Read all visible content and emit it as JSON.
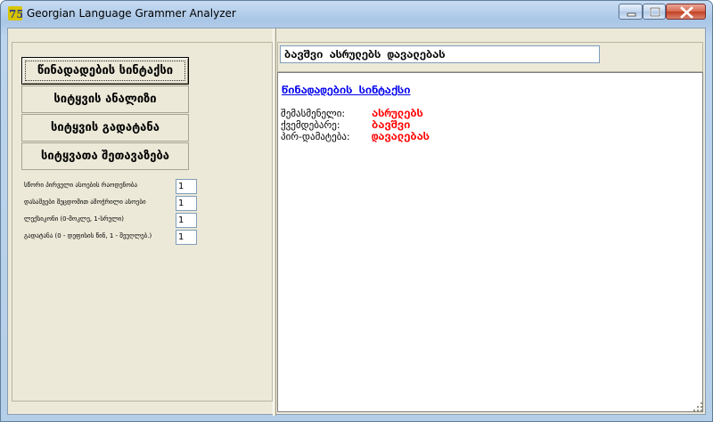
{
  "window": {
    "title": "Georgian Language Grammer Analyzer"
  },
  "controls": {
    "minimize": "minimize",
    "maximize": "maximize",
    "close": "close"
  },
  "left_panel": {
    "buttons": [
      "წინადადების სინტაქსი",
      "სიტყვის ანალიზი",
      "სიტყვის გადატანა",
      "სიტყვათა შეთავაზება"
    ],
    "params": [
      {
        "label": "სწორი პირველი ასოების რაოდენობა",
        "value": "1"
      },
      {
        "label": "დასაშვები შეცდომით ამოჭრილი  ასოები",
        "value": "1"
      },
      {
        "label": "ლექსიკონი (0-მოკლე, 1-სრული)",
        "value": "1"
      },
      {
        "label": "გადატანა (0 - დეფისის წინ, 1 - შეუღლებ.)",
        "value": "1"
      }
    ]
  },
  "right_panel": {
    "sentence": "ბავშვი ასრულებს დავალებას",
    "result_title": "წინადადების სინტაქსი",
    "result_rows": [
      {
        "label": "შემასმენელი:",
        "value": "ასრულებს"
      },
      {
        "label": "ქვემდებარე:",
        "value": "ბავშვი"
      },
      {
        "label": "პირ-დამატება:",
        "value": "დავალებას"
      }
    ]
  },
  "colors": {
    "link": "#0000ee",
    "result_value": "#ff0000",
    "window_face": "#ece9d8"
  },
  "icons": {
    "app": "app-icon",
    "grip": "resize-grip-icon"
  }
}
